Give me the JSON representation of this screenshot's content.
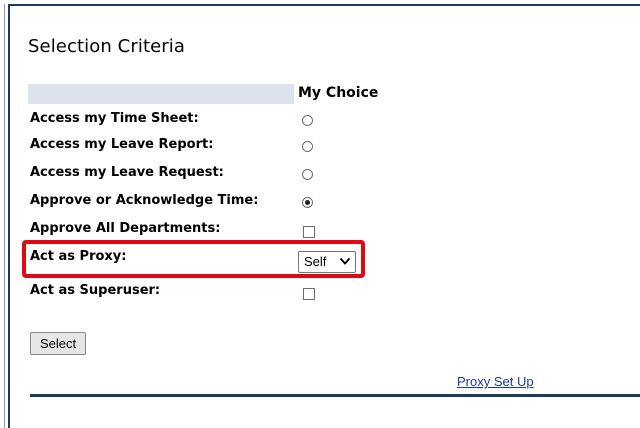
{
  "section": {
    "title": "Selection Criteria",
    "column_header": "My Choice"
  },
  "options": [
    {
      "label": "Access my Time Sheet:",
      "control": "radio",
      "checked": false
    },
    {
      "label": "Access my Leave Report:",
      "control": "radio",
      "checked": false
    },
    {
      "label": "Access my Leave Request:",
      "control": "radio",
      "checked": false
    },
    {
      "label": "Approve or Acknowledge Time:",
      "control": "radio",
      "checked": true
    },
    {
      "label": "Approve All Departments:",
      "control": "checkbox",
      "checked": false
    },
    {
      "label": "Act as Proxy:",
      "control": "select",
      "value": "Self"
    },
    {
      "label": "Act as Superuser:",
      "control": "checkbox",
      "checked": false
    }
  ],
  "actions": {
    "select_label": "Select",
    "proxy_link": "Proxy Set Up"
  },
  "colors": {
    "frame": "#1f3a5f",
    "header_bar": "#dde3ee",
    "highlight": "#e30613",
    "link": "#1a3aa8"
  }
}
